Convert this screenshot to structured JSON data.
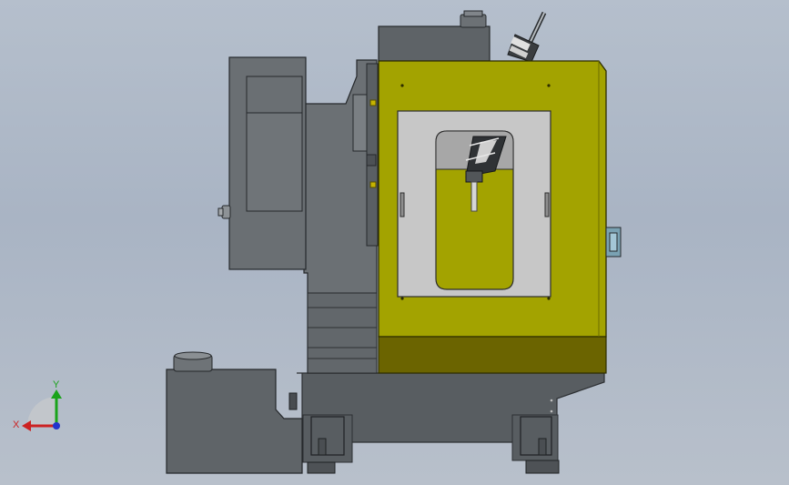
{
  "viewport": {
    "background_color": "#b3bdca"
  },
  "triad": {
    "x_label": "X",
    "y_label": "Y",
    "x_color": "#cc2222",
    "y_color": "#1aa31a",
    "z_color": "#2233cc"
  },
  "machine": {
    "enclosure_color": "#a3a300",
    "enclosure_shadow_color": "#6b6400",
    "frame_color": "#5d6266",
    "body_color": "#6d7276",
    "window_glass_color": "#c7c7c7",
    "icons": [
      "machining-center-model-icon",
      "spindle-icon",
      "tool-magazine-icon"
    ]
  }
}
